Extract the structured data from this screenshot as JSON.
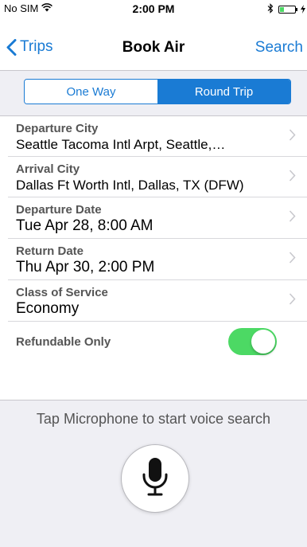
{
  "status_bar": {
    "carrier": "No SIM",
    "time": "2:00 PM",
    "battery_level": 0.25,
    "icons": [
      "wifi-icon",
      "bluetooth-icon",
      "battery-icon",
      "charging-icon"
    ]
  },
  "nav": {
    "back_label": "Trips",
    "title": "Book Air",
    "action_label": "Search"
  },
  "trip_type": {
    "options": [
      "One Way",
      "Round Trip"
    ],
    "selected": "Round Trip"
  },
  "fields": [
    {
      "label": "Departure City",
      "value": "Seattle Tacoma Intl Arpt, Seattle,…"
    },
    {
      "label": "Arrival City",
      "value": "Dallas Ft Worth Intl, Dallas, TX (DFW)"
    },
    {
      "label": "Departure Date",
      "value": "Tue Apr 28, 8:00 AM"
    },
    {
      "label": "Return Date",
      "value": "Thu Apr 30, 2:00 PM"
    },
    {
      "label": "Class of Service",
      "value": "Economy"
    }
  ],
  "refundable": {
    "label": "Refundable Only",
    "enabled": true
  },
  "voice": {
    "hint": "Tap Microphone to start voice search",
    "icon": "microphone-icon"
  },
  "colors": {
    "accent": "#1a7bd4",
    "toggle_on": "#4cd964",
    "background_gray": "#efeff4"
  }
}
